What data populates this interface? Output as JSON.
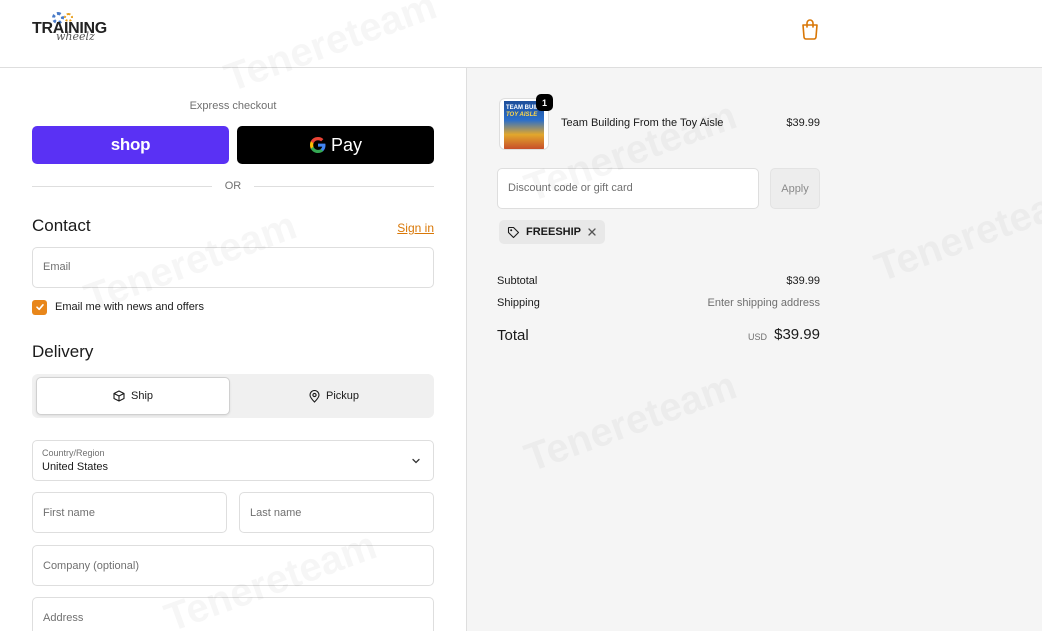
{
  "header": {
    "logo_text": "TRAINING",
    "logo_script": "wheelz",
    "bag_icon": "shopping-bag-icon",
    "accent_color": "#d97706"
  },
  "express": {
    "label": "Express checkout",
    "shop_label": "shop",
    "gpay_label": "Pay",
    "or_label": "OR"
  },
  "contact": {
    "title": "Contact",
    "sign_in": "Sign in",
    "email_placeholder": "Email",
    "newsletter_label": "Email me with news and offers",
    "newsletter_checked": true
  },
  "delivery": {
    "title": "Delivery",
    "ship_label": "Ship",
    "pickup_label": "Pickup",
    "selected": "Ship",
    "country_label": "Country/Region",
    "country_value": "United States",
    "first_name_placeholder": "First name",
    "last_name_placeholder": "Last name",
    "company_placeholder": "Company (optional)",
    "address_placeholder": "Address"
  },
  "summary": {
    "product": {
      "name": "Team Building From the Toy Aisle",
      "price": "$39.99",
      "quantity": "1",
      "thumb_line1": "TEAM BUILDI",
      "thumb_line2": "TOY AISLE"
    },
    "discount_placeholder": "Discount code or gift card",
    "apply_label": "Apply",
    "applied_code": "FREESHIP",
    "subtotal_label": "Subtotal",
    "subtotal_value": "$39.99",
    "shipping_label": "Shipping",
    "shipping_value": "Enter shipping address",
    "total_label": "Total",
    "total_currency": "USD",
    "total_value": "$39.99"
  },
  "watermark": "Tenereteam"
}
